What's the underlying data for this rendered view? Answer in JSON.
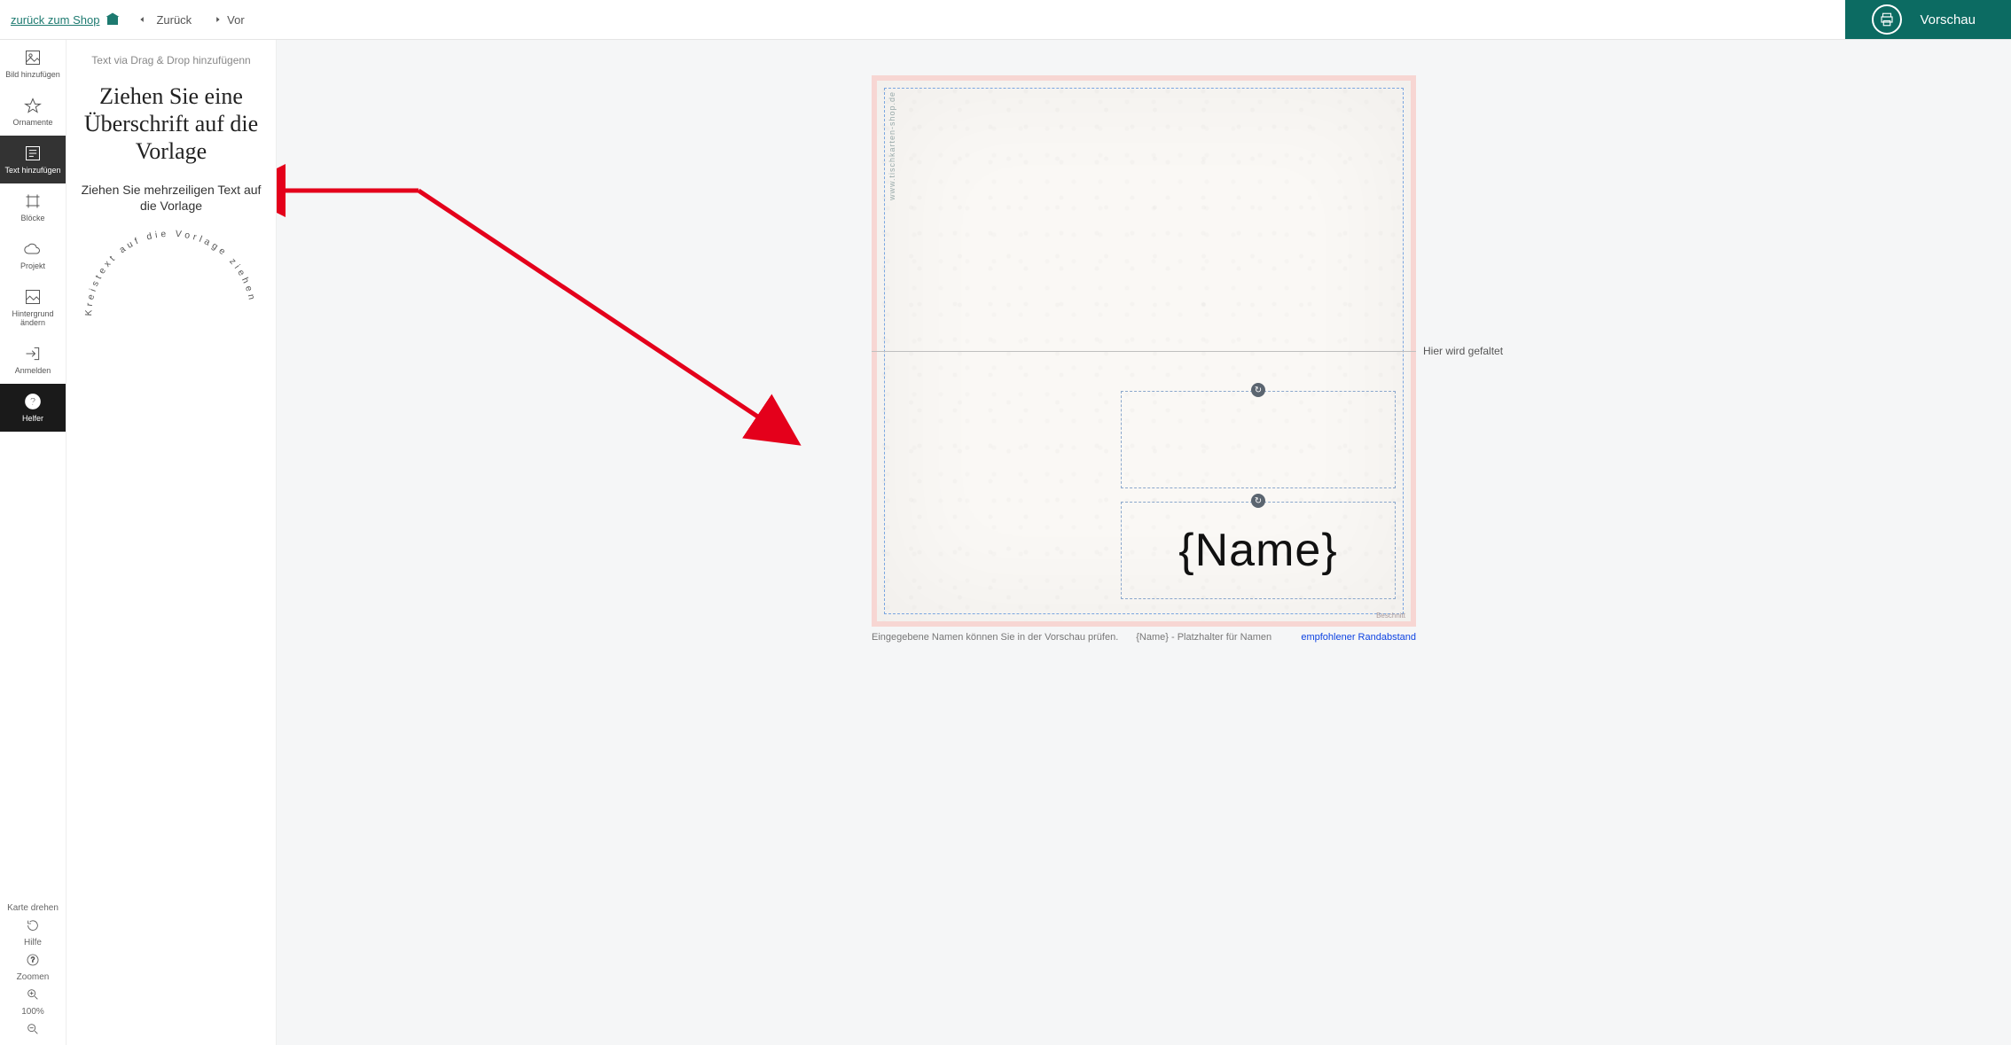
{
  "header": {
    "back_to_shop": "zurück zum Shop",
    "undo": "Zurück",
    "redo": "Vor",
    "preview": "Vorschau"
  },
  "rail": {
    "items": [
      {
        "id": "add-image",
        "label": "Bild hinzufügen"
      },
      {
        "id": "ornaments",
        "label": "Ornamente"
      },
      {
        "id": "add-text",
        "label": "Text hinzufügen"
      },
      {
        "id": "blocks",
        "label": "Blöcke"
      },
      {
        "id": "project",
        "label": "Projekt"
      },
      {
        "id": "background",
        "label": "Hintergrund ändern"
      },
      {
        "id": "login",
        "label": "Anmelden"
      },
      {
        "id": "helper",
        "label": "Helfer"
      }
    ],
    "rotate_card": "Karte drehen",
    "help": "Hilfe",
    "zoom": "Zoomen",
    "zoom_value": "100%"
  },
  "panel": {
    "hint": "Text via Drag & Drop hinzufügenn",
    "heading_drag": "Ziehen Sie eine Überschrift auf die Vorlage",
    "multiline_drag": "Ziehen Sie mehrzeiligen Text auf die Vorlage",
    "circle_text": "Kreistext auf die Vorlage ziehen"
  },
  "canvas": {
    "watermark": "www.tischkarten-shop.de",
    "fold_label": "Hier wird gefaltet",
    "bleed": "Beschnitt",
    "name_placeholder": "{Name}",
    "footer_left": "Eingegebene Namen können Sie in der Vorschau prüfen.",
    "footer_mid": "{Name} - Platzhalter für Namen",
    "footer_right": "empfohlener Randabstand"
  }
}
